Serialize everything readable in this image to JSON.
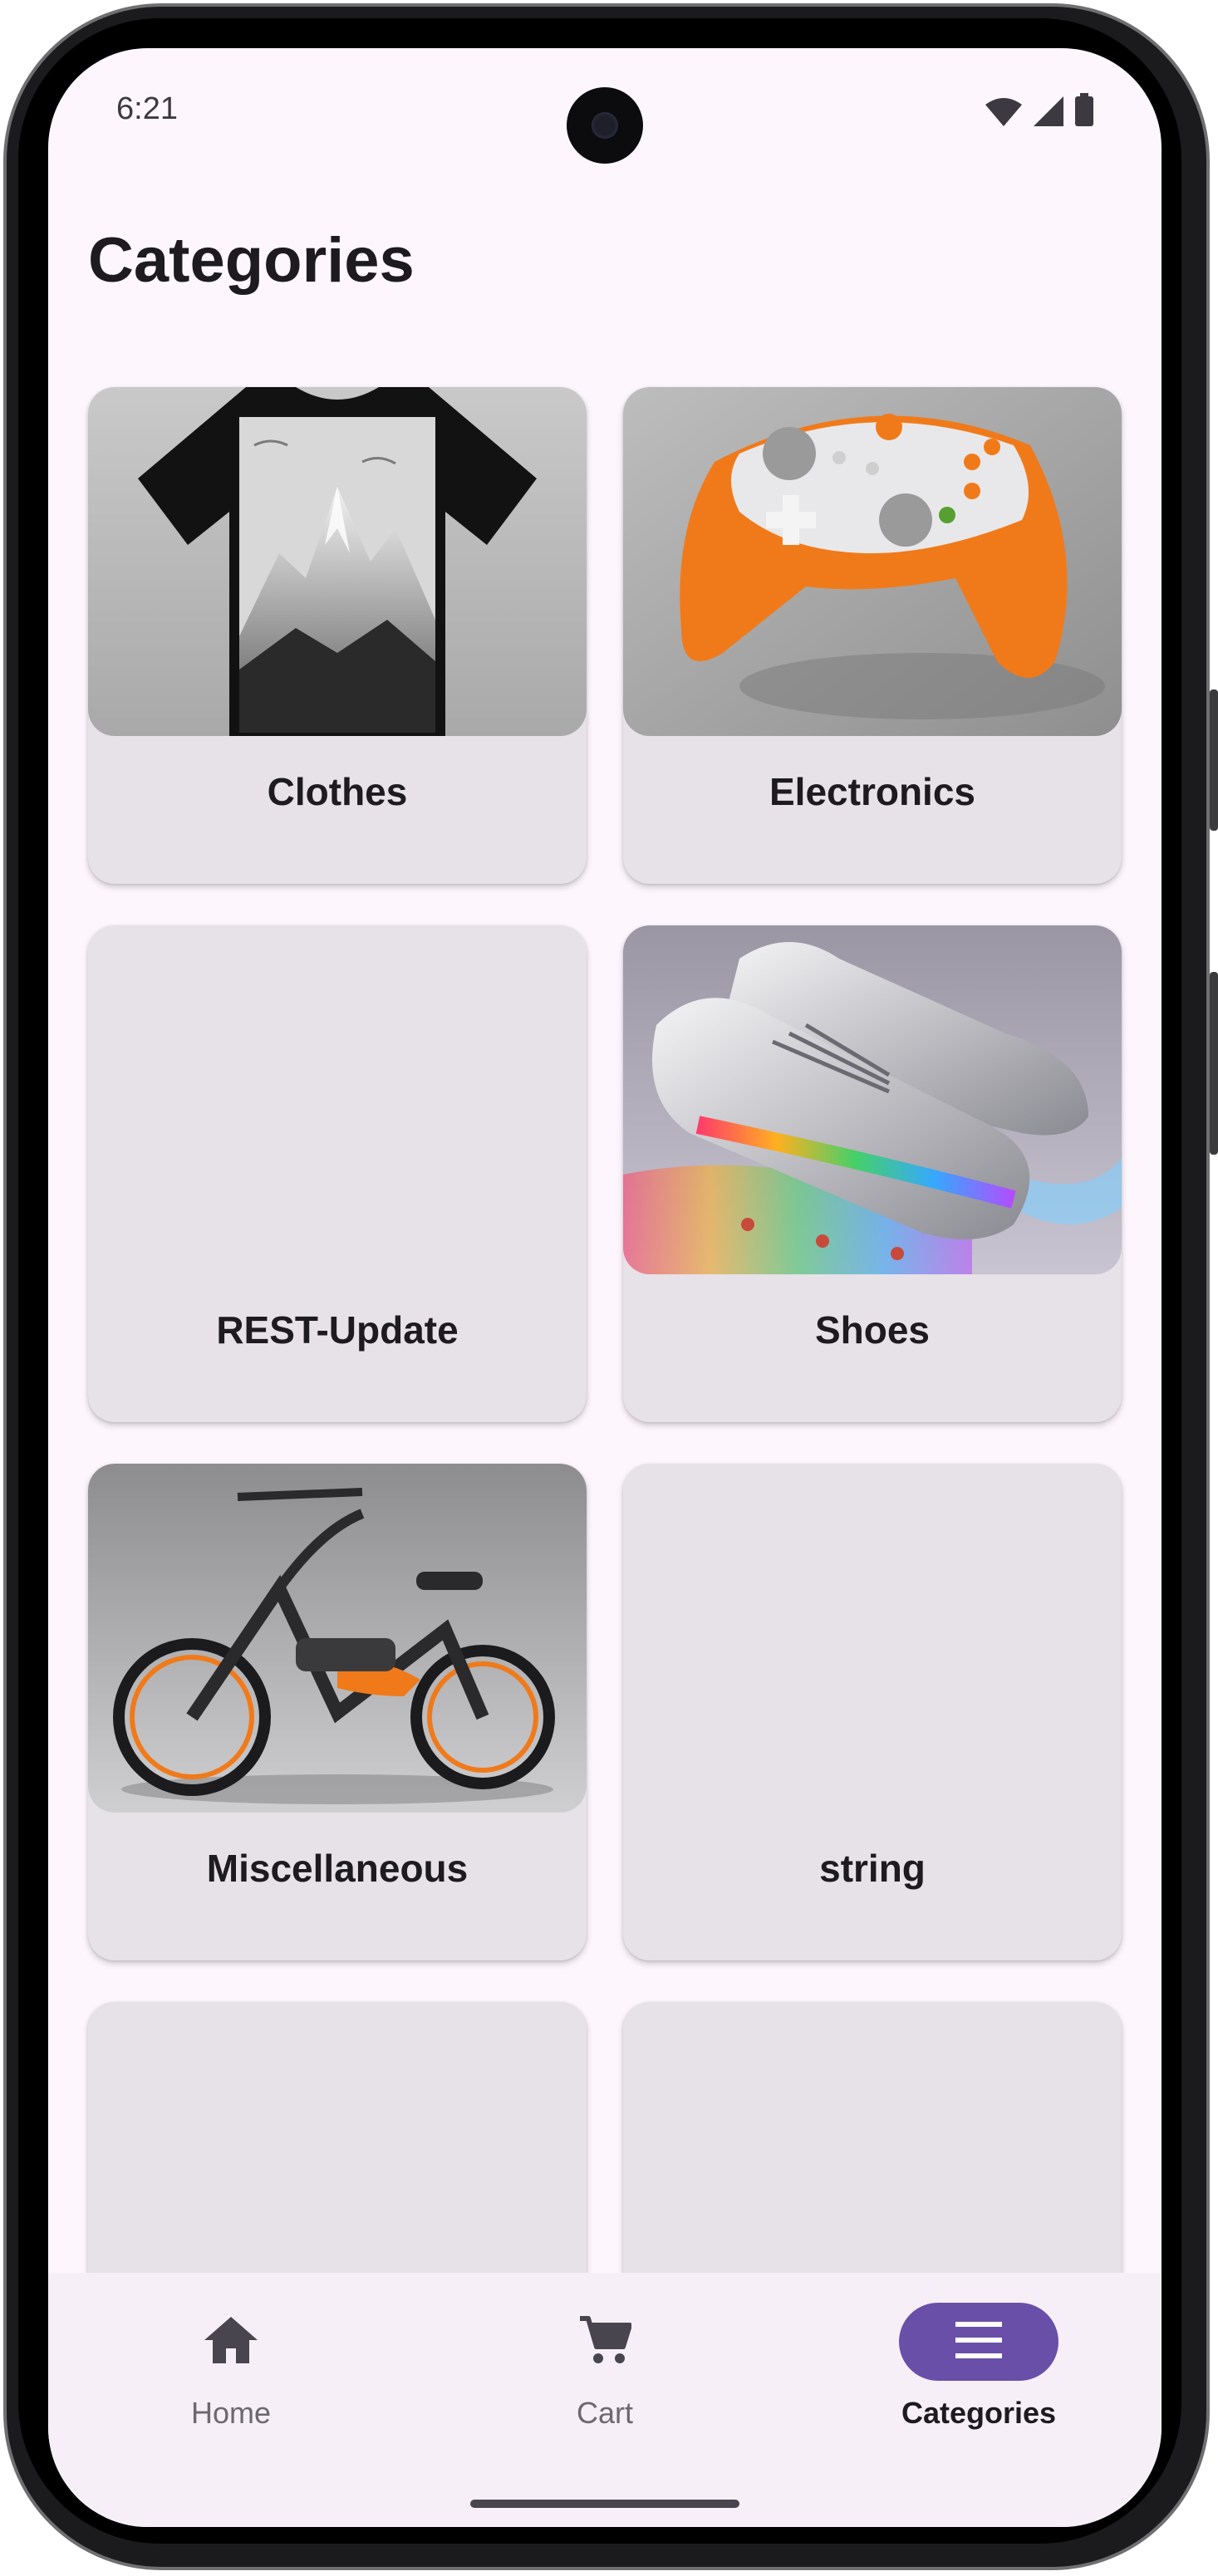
{
  "status_bar": {
    "time": "6:21",
    "icons": [
      "wifi-icon",
      "signal-icon",
      "battery-icon"
    ]
  },
  "page": {
    "title": "Categories"
  },
  "categories": [
    {
      "label": "Clothes",
      "image": "mountain-tshirt-image"
    },
    {
      "label": "Electronics",
      "image": "game-controller-image"
    },
    {
      "label": "REST-Update",
      "image": ""
    },
    {
      "label": "Shoes",
      "image": "silver-sneakers-image"
    },
    {
      "label": "Miscellaneous",
      "image": "electric-bike-image"
    },
    {
      "label": "string",
      "image": ""
    },
    {
      "label": "",
      "image": ""
    },
    {
      "label": "",
      "image": ""
    }
  ],
  "bottom_nav": {
    "items": [
      {
        "label": "Home",
        "icon": "home-icon",
        "active": false
      },
      {
        "label": "Cart",
        "icon": "cart-icon",
        "active": false
      },
      {
        "label": "Categories",
        "icon": "menu-icon",
        "active": true
      }
    ]
  },
  "colors": {
    "background": "#fdf7fd",
    "card": "#e7e1e8",
    "accent": "#6a4fa8",
    "nav_background": "#f6eff7"
  }
}
